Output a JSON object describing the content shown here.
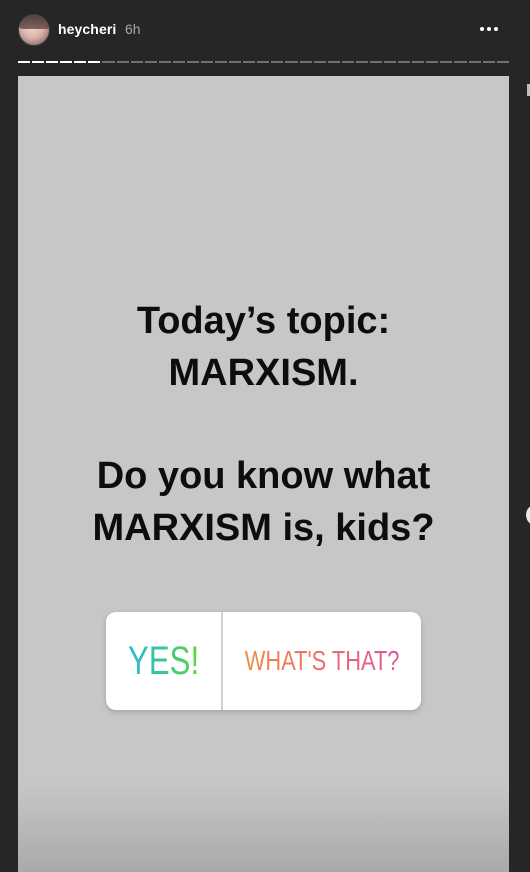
{
  "header": {
    "username": "heycheri",
    "time": "6h"
  },
  "progress": {
    "total_segments": 35,
    "completed_segments": 6
  },
  "story": {
    "topic_line1": "Today’s topic:",
    "topic_line2": "MARXISM.",
    "question_line1": "Do you know what",
    "question_line2": "MARXISM is, kids?"
  },
  "poll": {
    "option_a": "YES!",
    "option_b": "WHAT'S THAT?"
  },
  "colors": {
    "background": "#262626",
    "story_bg": "#c7c7c7",
    "text": "#0d0d0d"
  },
  "icons": {
    "more": "more-horizontal-icon",
    "avatar": "avatar"
  }
}
